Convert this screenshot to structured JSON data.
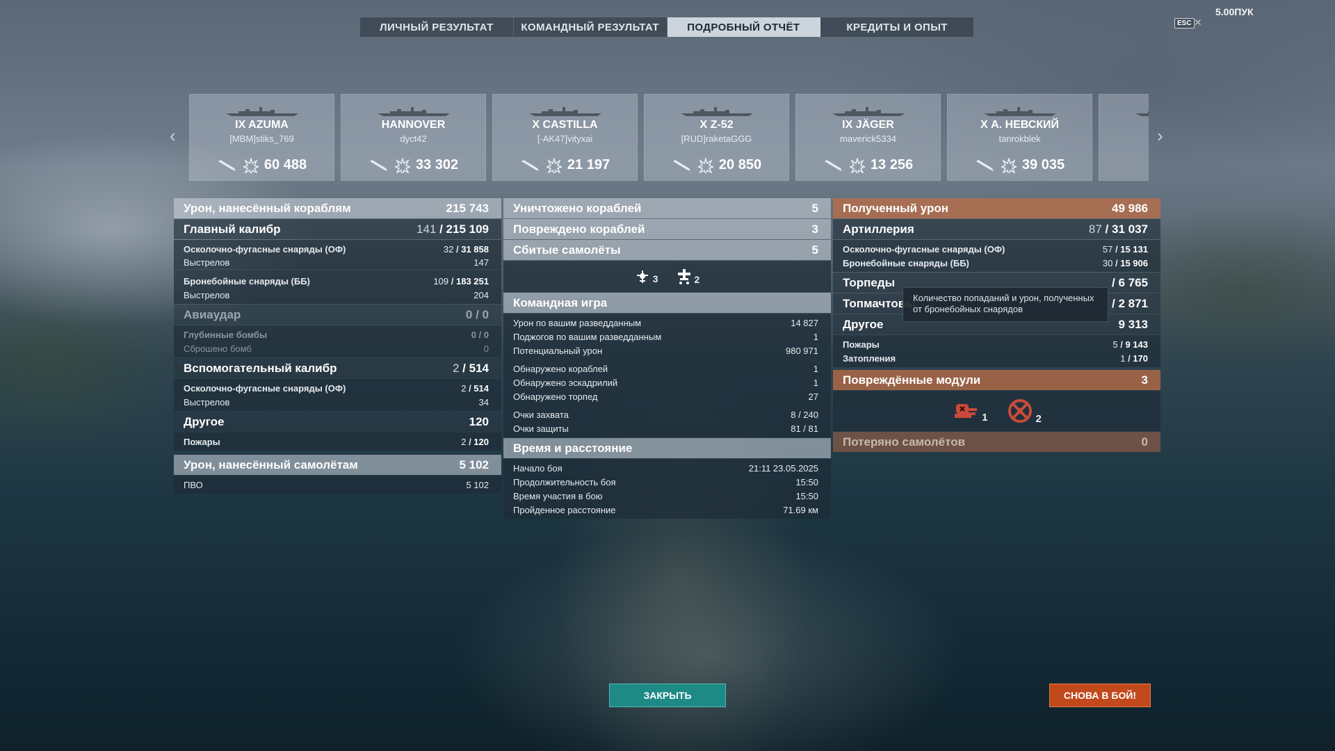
{
  "tabs": [
    "ЛИЧНЫЙ РЕЗУЛЬТАТ",
    "КОМАНДНЫЙ РЕЗУЛЬТАТ",
    "ПОДРОБНЫЙ ОТЧЁТ",
    "КРЕДИТЫ И ОПЫТ"
  ],
  "active_tab": "ПОДРОБНЫЙ ОТЧЁТ",
  "esc": "ESC",
  "version": "5.00ПУК",
  "ships": [
    {
      "name": "IX AZUMA",
      "player": "[MBM]stiks_769",
      "damage": "60 488"
    },
    {
      "name": "HANNOVER",
      "player": "dyct42",
      "damage": "33 302"
    },
    {
      "name": "X CASTILLA",
      "player": "[-AK47]vityxai",
      "damage": "21 197"
    },
    {
      "name": "X Z-52",
      "player": "[RUD]raketaGGG",
      "damage": "20 850"
    },
    {
      "name": "IX JÄGER",
      "player": "maverick5334",
      "damage": "13 256"
    },
    {
      "name": "X А. НЕВСКИЙ",
      "player": "tanrokblek",
      "damage": "39 035"
    }
  ],
  "left": {
    "dmg_ships": {
      "label": "Урон, нанесённый кораблям",
      "value": "215 743"
    },
    "main": {
      "label": "Главный калибр",
      "hits": "141",
      "value": "215 109"
    },
    "main_he": {
      "label": "Осколочно-фугасные снаряды (ОФ)",
      "hits": "32",
      "value": "31 858"
    },
    "main_he_shots": {
      "label": "Выстрелов",
      "value": "147"
    },
    "main_ap": {
      "label": "Бронебойные снаряды (ББ)",
      "hits": "109",
      "value": "183 251"
    },
    "main_ap_shots": {
      "label": "Выстрелов",
      "value": "204"
    },
    "air": {
      "label": "Авиаудар",
      "value": "0 / 0"
    },
    "depth": {
      "label": "Глубинные бомбы",
      "value": "0 / 0"
    },
    "dropped": {
      "label": "Сброшено бомб",
      "value": "0"
    },
    "sec": {
      "label": "Вспомогательный калибр",
      "hits": "2",
      "value": "514"
    },
    "sec_he": {
      "label": "Осколочно-фугасные снаряды (ОФ)",
      "hits": "2",
      "value": "514"
    },
    "sec_shots": {
      "label": "Выстрелов",
      "value": "34"
    },
    "other": {
      "label": "Другое",
      "value": "120"
    },
    "fires": {
      "label": "Пожары",
      "hits": "2",
      "value": "120"
    },
    "dmg_planes": {
      "label": "Урон, нанесённый самолётам",
      "value": "5 102"
    },
    "aa": {
      "label": "ПВО",
      "value": "5 102"
    }
  },
  "mid": {
    "destroyed": {
      "label": "Уничтожено кораблей",
      "value": "5"
    },
    "damaged": {
      "label": "Повреждено кораблей",
      "value": "3"
    },
    "planes": {
      "label": "Сбитые самолёты",
      "value": "5"
    },
    "plane_icons": [
      {
        "icon": "fighter-plane-icon",
        "count": "3"
      },
      {
        "icon": "bomber-plane-icon",
        "count": "2"
      }
    ],
    "team": {
      "label": "Командная игра"
    },
    "team_rows": [
      {
        "label": "Урон по вашим разведданным",
        "value": "14 827"
      },
      {
        "label": "Поджогов по вашим разведданным",
        "value": "1"
      },
      {
        "label": "Потенциальный урон",
        "value": "980 971"
      },
      {
        "label": "Обнаружено кораблей",
        "value": "1"
      },
      {
        "label": "Обнаружено эскадрилий",
        "value": "1"
      },
      {
        "label": "Обнаружено торпед",
        "value": "27"
      },
      {
        "label": "Очки захвата",
        "value": "8 / 240"
      },
      {
        "label": "Очки защиты",
        "value": "81 / 81"
      }
    ],
    "time": {
      "label": "Время и расстояние"
    },
    "time_rows": [
      {
        "label": "Начало боя",
        "value": "21:11  23.05.2025"
      },
      {
        "label": "Продолжительность боя",
        "value": "15:50"
      },
      {
        "label": "Время участия в бою",
        "value": "15:50"
      },
      {
        "label": "Пройденное расстояние",
        "value": "71.69 км"
      }
    ]
  },
  "right": {
    "received": {
      "label": "Полученный урон",
      "value": "49 986"
    },
    "art": {
      "label": "Артиллерия",
      "hits": "87",
      "value": "31 037"
    },
    "art_he": {
      "label": "Осколочно-фугасные снаряды (ОФ)",
      "hits": "57",
      "value": "15 131"
    },
    "art_ap": {
      "label": "Бронебойные снаряды (ББ)",
      "hits": "30",
      "value": "15 906"
    },
    "torp": {
      "label": "Торпеды",
      "value": "/ 6 765"
    },
    "topmast": {
      "label": "Топмачтовы",
      "value": "/ 2 871"
    },
    "other": {
      "label": "Другое",
      "value": "9 313"
    },
    "fires": {
      "label": "Пожары",
      "hits": "5",
      "value": "9 143"
    },
    "floods": {
      "label": "Затопления",
      "hits": "1",
      "value": "170"
    },
    "modules": {
      "label": "Повреждённые модули",
      "value": "3"
    },
    "module_icons": [
      {
        "icon": "turret-module-icon",
        "count": "1"
      },
      {
        "icon": "rudder-module-icon",
        "count": "2"
      }
    ],
    "lost": {
      "label": "Потеряно самолётов",
      "value": "0"
    }
  },
  "tooltip": "Количество попаданий и урон, полученных от бронебойных снарядов",
  "close_btn": "ЗАКРЫТЬ",
  "again_btn": "СНОВА В БОЙ!",
  "colors": {
    "close": "#1e8a86",
    "again": "#c2491c",
    "orange_header": "#be6e46"
  }
}
